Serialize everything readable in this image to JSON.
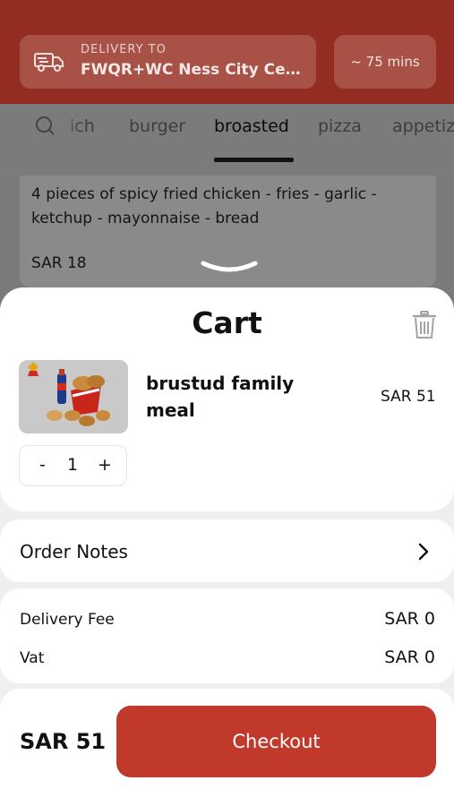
{
  "header": {
    "delivery_label": "DELIVERY TO",
    "address": "FWQR+WC Ness City Cen...",
    "eta": "~ 75 mins"
  },
  "tabs": {
    "items": [
      "ich",
      "burger",
      "broasted",
      "pizza",
      "appetiz"
    ],
    "active": "broasted"
  },
  "menu_item": {
    "description": "4 pieces of spicy fried chicken - fries - garlic - ketchup - mayonnaise - bread",
    "price": "SAR 18"
  },
  "cart": {
    "title": "Cart",
    "item": {
      "name": "brustud family meal",
      "price": "SAR 51",
      "quantity": "1",
      "minus": "-",
      "plus": "+"
    }
  },
  "order_notes": {
    "label": "Order Notes"
  },
  "fees": {
    "delivery_label": "Delivery Fee",
    "delivery_value": "SAR 0",
    "vat_label": "Vat",
    "vat_value": "SAR 0"
  },
  "footer": {
    "total": "SAR 51",
    "checkout_label": "Checkout"
  },
  "colors": {
    "brand_red": "#c0392b",
    "header_dimmed": "#932d22"
  }
}
